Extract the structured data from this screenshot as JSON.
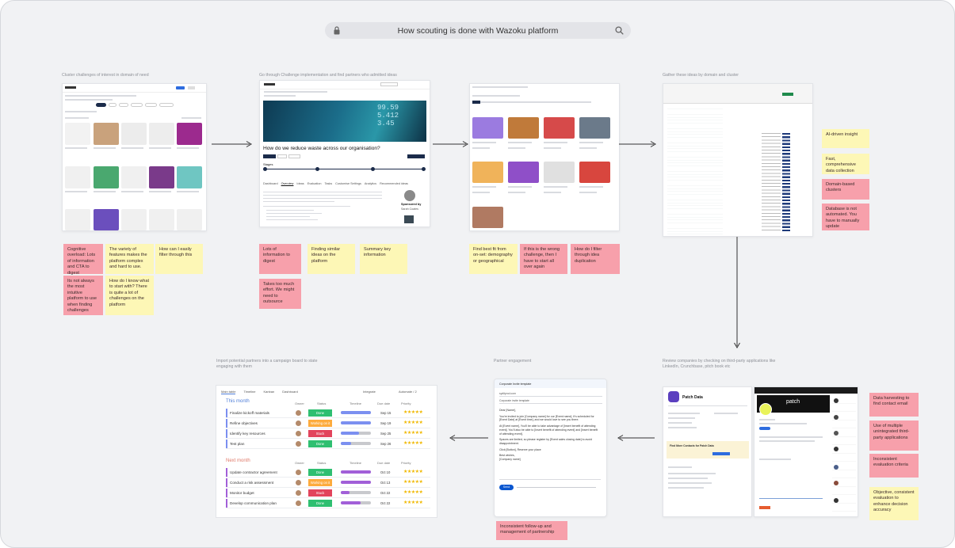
{
  "search": {
    "title": "How scouting is done with Wazoku platform"
  },
  "captions": {
    "step1": "Cluster challenges of interest in domain of need",
    "step2": "Go through Challenge implementation and find partners who admitted ideas",
    "step3": "Gather these ideas by domain and cluster",
    "step4": "Review companies by checking on third-party applications like LinkedIn, Crunchbase, pitch book etc",
    "step5": "Partner engagement",
    "step6": "Import potential partners into a campaign board to state engaging with them"
  },
  "notes": {
    "n1": "Cognitive overload: Lots of information and CTA to digest",
    "n2": "The variety of features makes the platform complex and hard to use.",
    "n3": "How can I easily filter through this",
    "n4": "Its not always the most intuitive platform to use when finding challenges",
    "n5": "How do I know what to start with? There is quite a lot of challenges on the platform",
    "n6": "Lots of information to digest",
    "n7": "Finding similar ideas on the platform",
    "n8": "Summary key information",
    "n9": "Takes too much effort. We might need to outsource",
    "n10": "Find best fit from on-set: demography or geographical",
    "n11": "If this is the wrong challenge, then I have to start all over again",
    "n12": "How do I filter through idea duplication",
    "n13": "AI-driven insight",
    "n14": "Fast, comprehensive data collection",
    "n15": "Domain-based clusters",
    "n16": "Database is not automated. You have to manually update",
    "n17": "Data harvesting to find contact email",
    "n18": "Use of multiple unintegrated third-party applications",
    "n19": "Inconsistent evaluation criteria",
    "n20": "Objective, consistent evaluation to enhance decision accuracy",
    "n21": "Inconsistent follow-up and management of partnership"
  },
  "challenge_page": {
    "title": "How do we reduce waste across our organisation?",
    "stages_label": "Stages",
    "tabs": [
      "Dashboard",
      "Overview",
      "Ideas",
      "Evaluation",
      "Tasks",
      "Customise Settings",
      "Analytics",
      "Recommended ideas"
    ],
    "sponsored_by": "Sponsored by",
    "sponsor_name": "Sarah Coates"
  },
  "company_page": {
    "name": "Patch Data",
    "find_more": "Find More Contacts for Patch Data",
    "banner": "patch"
  },
  "email": {
    "title": "Corporate Invite template",
    "to": "sydityrod.com",
    "subject": "Corporate invite template",
    "greeting": "Dear [Name],",
    "body1": "You're invited to join [Company name] for our [Event name]. It's scheduled for [Event Date] at [Event time], and we would love to see you there.",
    "body2": "At [Event name], You'll be able to take advantage of [Insert benefit of attending event]. You'll also be able to [Insert benefit of attending event] and [Insert benefit of attending event].",
    "body3": "Spaces are limited, so please register by [Event sales closing date] to avoid disappointment.",
    "body4": "Click [Button], Reserve your place",
    "closing": "Best wishes,",
    "sign": "[Company name]",
    "send": "Send"
  },
  "board": {
    "tabs": [
      "Main table",
      "Timeline",
      "Kanban",
      "Dashboard"
    ],
    "integrate": "Integrate",
    "automate": "Automate / 2",
    "group1": "This month",
    "group2": "Next month",
    "columns": {
      "owner": "Owner",
      "status": "Status",
      "timeline": "Timeline",
      "due": "Due date",
      "priority": "Priority"
    },
    "rows1": [
      {
        "task": "Finalize kickoff materials",
        "status": "Done",
        "due": "Sep 15",
        "color": "#2fbf71",
        "fill": 1.0,
        "tlcolor": "#7b8ff0"
      },
      {
        "task": "Refine objectives",
        "status": "Working on it",
        "due": "Sep 19",
        "color": "#fdab3d",
        "fill": 1.0,
        "tlcolor": "#7b8ff0"
      },
      {
        "task": "Identify key resources",
        "status": "Stuck",
        "due": "Sep 25",
        "color": "#e2445c",
        "fill": 0.6,
        "tlcolor": "#7b8ff0"
      },
      {
        "task": "Test plan",
        "status": "Done",
        "due": "Sep 26",
        "color": "#2fbf71",
        "fill": 0.35,
        "tlcolor": "#7b8ff0"
      }
    ],
    "rows2": [
      {
        "task": "Update contractor agreement",
        "status": "Done",
        "due": "Oct 10",
        "color": "#2fbf71",
        "fill": 1.0,
        "tlcolor": "#a15fd8"
      },
      {
        "task": "Conduct a risk assessment",
        "status": "Working on it",
        "due": "Oct 13",
        "color": "#fdab3d",
        "fill": 1.0,
        "tlcolor": "#a15fd8"
      },
      {
        "task": "Monitor budget",
        "status": "Stuck",
        "due": "Oct 22",
        "color": "#e2445c",
        "fill": 0.3,
        "tlcolor": "#a15fd8"
      },
      {
        "task": "Develop communication plan",
        "status": "Done",
        "due": "Oct 22",
        "color": "#2fbf71",
        "fill": 0.65,
        "tlcolor": "#a15fd8"
      }
    ],
    "stars": "★★★★★"
  }
}
